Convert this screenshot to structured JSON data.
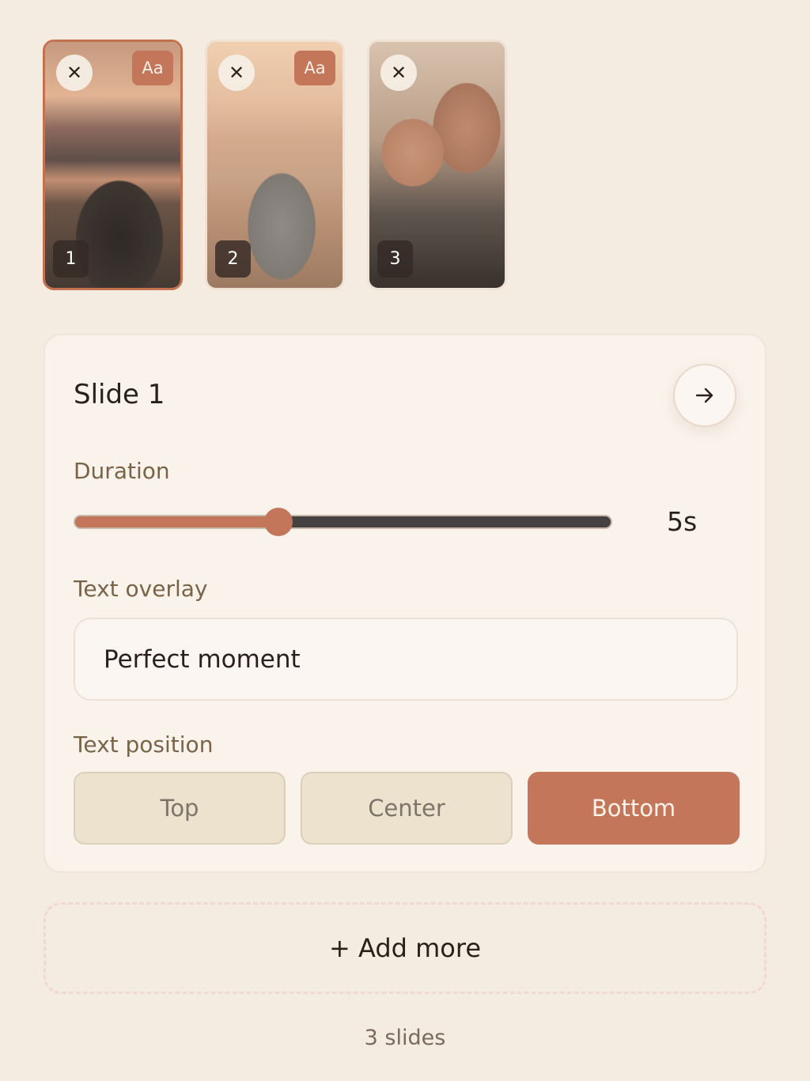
{
  "thumbnails": [
    {
      "number": "1",
      "has_text": true,
      "close": "✕",
      "text_badge": "Aa",
      "selected": true
    },
    {
      "number": "2",
      "has_text": true,
      "close": "✕",
      "text_badge": "Aa",
      "selected": false
    },
    {
      "number": "3",
      "has_text": false,
      "close": "✕",
      "text_badge": "",
      "selected": false
    }
  ],
  "editor": {
    "title": "Slide 1",
    "next_icon": "arrow-right-icon",
    "duration_label": "Duration",
    "duration_value": "5s",
    "duration_fraction": 0.38,
    "text_overlay_label": "Text overlay",
    "text_overlay_value": "Perfect moment",
    "text_position_label": "Text position",
    "positions": [
      {
        "label": "Top",
        "active": false
      },
      {
        "label": "Center",
        "active": false
      },
      {
        "label": "Bottom",
        "active": true
      }
    ]
  },
  "add_more_label": "+ Add more",
  "slide_count": "3 slides",
  "colors": {
    "accent": "#c4765a",
    "background": "#f4ebe1",
    "card": "#f9f3ec"
  }
}
